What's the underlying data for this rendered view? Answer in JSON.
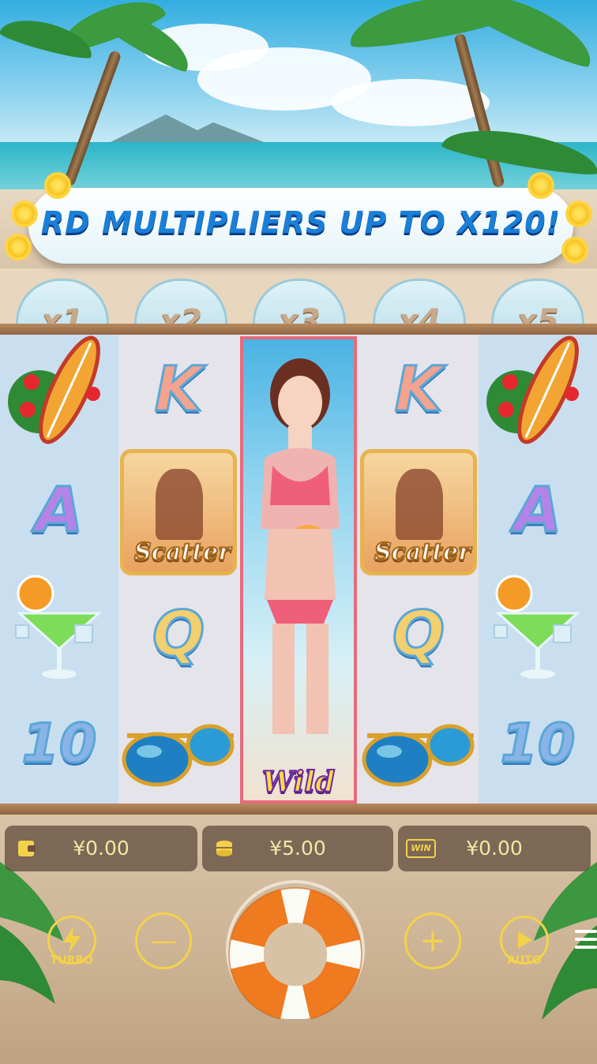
{
  "banner": {
    "text": "RD MULTIPLIERS UP TO X120!"
  },
  "multipliers": [
    "x1",
    "x2",
    "x3",
    "x4",
    "x5"
  ],
  "reels": {
    "reel1": [
      "surfboard",
      "A",
      "cocktail",
      "10"
    ],
    "reel2": [
      "K",
      "Scatter",
      "Q",
      "sunglasses"
    ],
    "reel3": [
      "Wild"
    ],
    "reel4": [
      "K",
      "Scatter",
      "Q",
      "sunglasses"
    ],
    "reel5": [
      "surfboard",
      "A",
      "cocktail",
      "10"
    ]
  },
  "symbols": {
    "scatter_label": "Scatter",
    "wild_label": "Wild"
  },
  "info_bar": {
    "balance": "¥0.00",
    "bet": "¥5.00",
    "win": "¥0.00",
    "win_badge": "WIN"
  },
  "controls": {
    "turbo_label": "TURBO",
    "auto_label": "AUTO",
    "minus": "—",
    "plus": "+"
  },
  "colors": {
    "accent": "#f3d24b",
    "banner_text": "#1a7fd6",
    "panel_text": "#f4e6a6",
    "wild_reel_border": "#e86a7a"
  },
  "icons": [
    "wallet-icon",
    "coins-icon",
    "win-icon",
    "lightning-icon",
    "play-icon",
    "menu-icon",
    "lifebuoy-icon"
  ]
}
